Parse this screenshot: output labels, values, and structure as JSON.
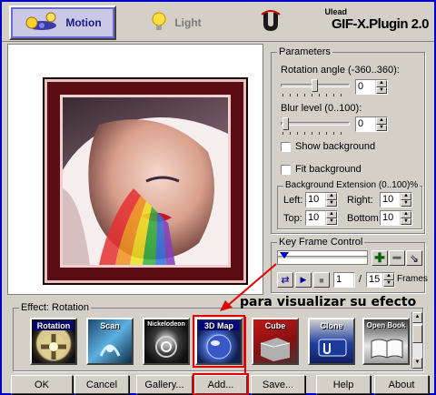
{
  "tabs": [
    {
      "label": "Motion"
    },
    {
      "label": "Light"
    }
  ],
  "brand": {
    "ulead": "Ulead",
    "title": "GIF-X.Plugin 2.0"
  },
  "params": {
    "title": "Parameters",
    "rotation_label": "Rotation angle (-360..360):",
    "rotation_value": "0",
    "blur_label": "Blur level (0..100):",
    "blur_value": "0",
    "show_bg": "Show background",
    "fit_bg": "Fit background",
    "ext_title": "Background Extension (0..100)%",
    "left_label": "Left:",
    "left_value": "10",
    "right_label": "Right:",
    "right_value": "10",
    "top_label": "Top:",
    "top_value": "10",
    "bottom_label": "Bottom:",
    "bottom_value": "10"
  },
  "keyframe": {
    "title": "Key Frame Control",
    "current": "1",
    "sep": "/",
    "total": "15",
    "frames_label": "Frames"
  },
  "effect": {
    "title": "Effect: Rotation",
    "items": [
      {
        "label": "Rotation"
      },
      {
        "label": "Scan"
      },
      {
        "label": "Nickelodeon"
      },
      {
        "label": "3D Map"
      },
      {
        "label": "Cube"
      },
      {
        "label": "Clone"
      },
      {
        "label": "Open Book"
      }
    ]
  },
  "annotation": "para visualizar su efecto",
  "buttons": {
    "ok": "OK",
    "cancel": "Cancel",
    "gallery": "Gallery...",
    "add": "Add...",
    "save": "Save...",
    "help": "Help",
    "about": "About"
  },
  "colors": {
    "accent": "#0000c8",
    "frame": "#5a0e14",
    "annotation_red": "#e00000"
  }
}
